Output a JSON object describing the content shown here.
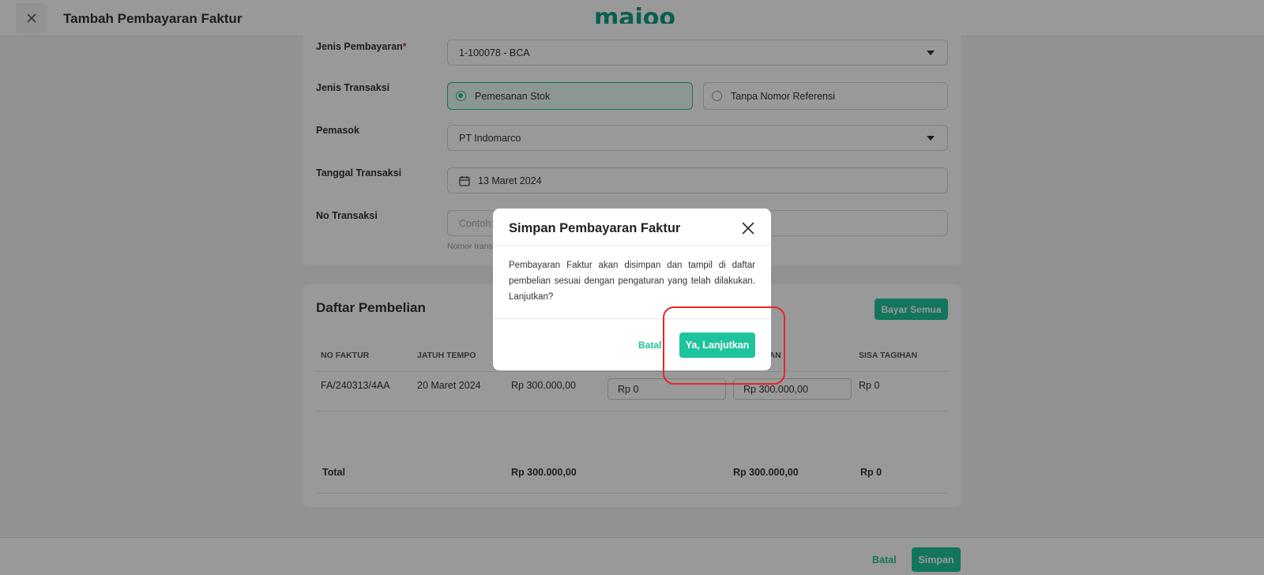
{
  "header": {
    "title": "Tambah Pembayaran Faktur",
    "logo": "majoo"
  },
  "form": {
    "payment_type": {
      "label": "Jenis Pembayaran",
      "required_mark": "*",
      "value": "1-100078 - BCA"
    },
    "transaction_type": {
      "label": "Jenis Transaksi",
      "options": [
        {
          "label": "Pemesanan Stok",
          "selected": true
        },
        {
          "label": "Tanpa Nomor Referensi",
          "selected": false
        }
      ]
    },
    "supplier": {
      "label": "Pemasok",
      "value": "PT Indomarco"
    },
    "transaction_date": {
      "label": "Tanggal Transaksi",
      "value": "13 Maret 2024"
    },
    "transaction_no": {
      "label": "No Transaksi",
      "placeholder": "Contoh:",
      "hint": "Nomor trans"
    }
  },
  "purchase_list": {
    "title": "Daftar Pembelian",
    "pay_all_label": "Bayar Semua",
    "columns": [
      "NO FAKTUR",
      "JATUH TEMPO",
      "RAN",
      "SISA TAGIHAN"
    ],
    "rows": [
      {
        "invoice_no": "FA/240313/4AA",
        "due_date": "20 Maret 2024",
        "amount": "Rp 300.000,00",
        "input1": "Rp 0",
        "input2": "Rp 300.000,00",
        "remaining": "Rp 0"
      }
    ],
    "total": {
      "label": "Total",
      "amount": "Rp 300.000,00",
      "payment": "Rp 300.000,00",
      "remaining": "Rp 0"
    }
  },
  "footer": {
    "cancel_label": "Batal",
    "save_label": "Simpan"
  },
  "modal": {
    "title": "Simpan Pembayaran Faktur",
    "body": "Pembayaran Faktur akan disimpan dan tampil di daftar pembelian sesuai dengan pengaturan yang telah dilakukan. Lanjutkan?",
    "cancel_label": "Batal",
    "confirm_label": "Ya, Lanjutkan"
  },
  "colors": {
    "accent": "#1ec49c",
    "logo": "#0e9f86",
    "highlight": "#e8242a"
  }
}
